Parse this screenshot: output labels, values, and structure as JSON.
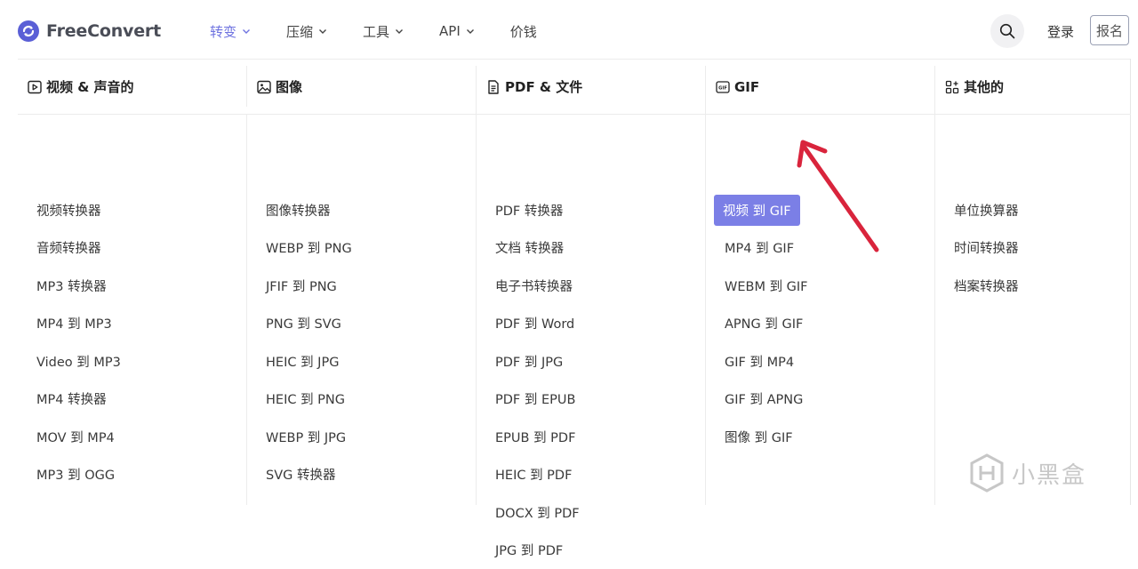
{
  "brand": {
    "name_part1": "Free",
    "name_part2": "Convert"
  },
  "nav": {
    "menu": [
      {
        "label": "转变",
        "active": true
      },
      {
        "label": "压缩",
        "active": false
      },
      {
        "label": "工具",
        "active": false
      },
      {
        "label": "API",
        "active": false
      },
      {
        "label": "价钱",
        "active": false
      }
    ],
    "login": "登录",
    "signup": "报名"
  },
  "columns": [
    {
      "title": "视频 & 声音的",
      "icon": "video-icon",
      "items": [
        "视频转换器",
        "音频转换器",
        "MP3 转换器",
        "MP4 到 MP3",
        "Video 到 MP3",
        "MP4 转换器",
        "MOV 到 MP4",
        "MP3 到 OGG"
      ]
    },
    {
      "title": "图像",
      "icon": "image-icon",
      "items": [
        "图像转换器",
        "WEBP 到 PNG",
        "JFIF 到 PNG",
        "PNG 到 SVG",
        "HEIC 到 JPG",
        "HEIC 到 PNG",
        "WEBP 到 JPG",
        "SVG 转换器"
      ]
    },
    {
      "title": "PDF & 文件",
      "icon": "document-icon",
      "items": [
        "PDF 转换器",
        "文档 转换器",
        "电子书转换器",
        "PDF 到 Word",
        "PDF 到 JPG",
        "PDF 到 EPUB",
        "EPUB 到 PDF",
        "HEIC 到 PDF",
        "DOCX 到 PDF",
        "JPG 到 PDF"
      ]
    },
    {
      "title": "GIF",
      "icon": "gif-icon",
      "items": [
        "视频 到 GIF",
        "MP4 到 GIF",
        "WEBM 到 GIF",
        "APNG 到 GIF",
        "GIF 到 MP4",
        "GIF 到 APNG",
        "图像 到 GIF"
      ],
      "highlighted_index": 0
    },
    {
      "title": "其他的",
      "icon": "grid-plus-icon",
      "items": [
        "单位换算器",
        "时间转换器",
        "档案转换器"
      ]
    }
  ],
  "watermark": {
    "text": "小黑盒"
  },
  "colors": {
    "accent": "#6f73e0",
    "highlight_bg": "#7b7fe6",
    "arrow": "#d9243c"
  }
}
